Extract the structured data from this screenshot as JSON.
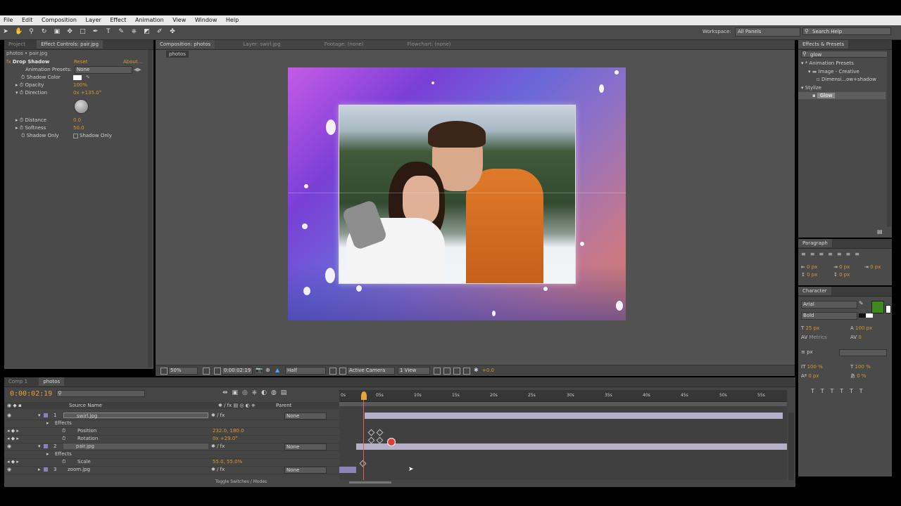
{
  "menu": [
    "File",
    "Edit",
    "Composition",
    "Layer",
    "Effect",
    "Animation",
    "View",
    "Window",
    "Help"
  ],
  "toolbar": {
    "workspace_label": "Workspace:",
    "workspace_value": "All Panels",
    "search_help": "Search Help"
  },
  "left_panel": {
    "tabs": [
      "Project",
      "Effect Controls: pair.jpg"
    ],
    "breadcrumb": "photos • pair.jpg",
    "effect_name": "Drop Shadow",
    "reset": "Reset",
    "about": "About...",
    "animation_presets_label": "Animation Presets:",
    "animation_presets_value": "None",
    "properties": [
      {
        "name": "Shadow Color",
        "value": ""
      },
      {
        "name": "Opacity",
        "value": "100%"
      },
      {
        "name": "Direction",
        "value": "0x +135.0°"
      },
      {
        "name": "Distance",
        "value": "0.0"
      },
      {
        "name": "Softness",
        "value": "50.0"
      },
      {
        "name": "Shadow Only",
        "value": "Shadow Only"
      }
    ]
  },
  "viewer": {
    "tabs": [
      "Composition: photos",
      "Layer: swirl.jpg",
      "Footage: (none)",
      "Flowchart: (none)"
    ],
    "comp_tab": "photos",
    "zoom": "50%",
    "timecode": "0:00:02:19",
    "resolution": "Half",
    "camera": "Active Camera",
    "view": "1 View",
    "exposure": "+0.0"
  },
  "effects_presets": {
    "title": "Effects & Presets",
    "search": "glow",
    "tree": [
      "* Animation Presets",
      "Image - Creative",
      "Dimensi...ow+shadow",
      "Stylize",
      "Glow"
    ]
  },
  "paragraph": {
    "title": "Paragraph",
    "fields": [
      "0 px",
      "0 px",
      "0 px",
      "0 px",
      "0 px"
    ]
  },
  "character": {
    "title": "Character",
    "font": "Arial",
    "style": "Bold",
    "size": "25 px",
    "leading": "100 px",
    "kerning": "Metrics",
    "tracking": "0",
    "stroke": "px",
    "vscale": "100 %",
    "hscale": "100 %",
    "baseline": "0 px",
    "tsume": "0 %"
  },
  "timeline": {
    "tabs": [
      "Comp 1",
      "photos"
    ],
    "timecode": "0:00:02:19",
    "col_source": "Source Name",
    "col_parent": "Parent",
    "ruler": [
      "0s",
      "05s",
      "10s",
      "15s",
      "20s",
      "25s",
      "30s",
      "35s",
      "40s",
      "45s",
      "50s",
      "55s"
    ],
    "layers": [
      {
        "num": "1",
        "name": "swirl.jpg",
        "parent": "None"
      },
      {
        "num": "2",
        "name": "pair.jpg",
        "parent": "None"
      },
      {
        "num": "3",
        "name": "zoom.jpg",
        "parent": "None"
      }
    ],
    "sub": [
      {
        "label": "Effects"
      },
      {
        "label": "Position",
        "value": "232.0, 180.0"
      },
      {
        "label": "Rotation",
        "value": "0x +29.0°"
      },
      {
        "label": "Effects"
      },
      {
        "label": "Scale",
        "value": "55.0, 55.0%"
      }
    ],
    "footer": "Toggle Switches / Modes"
  },
  "colors": {
    "accent": "#d79a2b",
    "panel": "#4a4a4a",
    "viewer_bg": "#525252",
    "layer_bar": "#b5b0c7",
    "playhead": "#e8a33a",
    "char_fill": "#3f8a1e"
  }
}
